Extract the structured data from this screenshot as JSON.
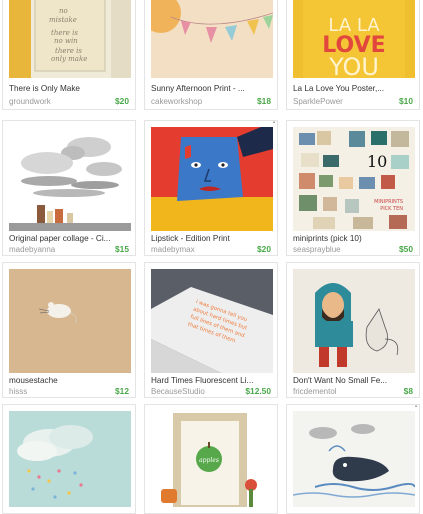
{
  "items": [
    {
      "title": "There is Only Make",
      "shop": "groundwork",
      "price": "$20",
      "art": {
        "text_lines": [
          "there is",
          "no",
          "mistake",
          "there is",
          "no win",
          "and no fail",
          "there is",
          "only make"
        ]
      }
    },
    {
      "title": "Sunny Afternoon Print - ...",
      "shop": "cakeworkshop",
      "price": "$18"
    },
    {
      "title": "La La Love You Poster,...",
      "shop": "SparklePower",
      "price": "$10",
      "art": {
        "line1": "LA LA",
        "line2": "LOVE",
        "line3": "YOU"
      }
    },
    {
      "title": "Original paper collage - Ci...",
      "shop": "madebyanna",
      "price": "$15"
    },
    {
      "title": "Lipstick - Edition Print",
      "shop": "madebymax",
      "price": "$20"
    },
    {
      "title": "miniprints (pick 10)",
      "shop": "seasprayblue",
      "price": "$50",
      "art": {
        "big": "10",
        "caption1": "MINIPRINTS",
        "caption2": "PICK TEN"
      }
    },
    {
      "title": "mousestache",
      "shop": "hisss",
      "price": "$12"
    },
    {
      "title": "Hard Times Fluorescent Li...",
      "shop": "BecauseStudio",
      "price": "$12.50",
      "art": {
        "text_lines": [
          "i was gonna tell you",
          "about hard times but",
          "full lines of them and",
          "that times of them"
        ]
      }
    },
    {
      "title": "Don't Want No Small Fe...",
      "shop": "fricdementol",
      "price": "$8"
    },
    {
      "title": "",
      "shop": "",
      "price": ""
    },
    {
      "title": "",
      "shop": "",
      "price": "",
      "art": {
        "word": "apples"
      }
    },
    {
      "title": "",
      "shop": "",
      "price": ""
    }
  ],
  "colors": {
    "price": "#4aa84a",
    "shop": "#999999",
    "title": "#333333"
  }
}
